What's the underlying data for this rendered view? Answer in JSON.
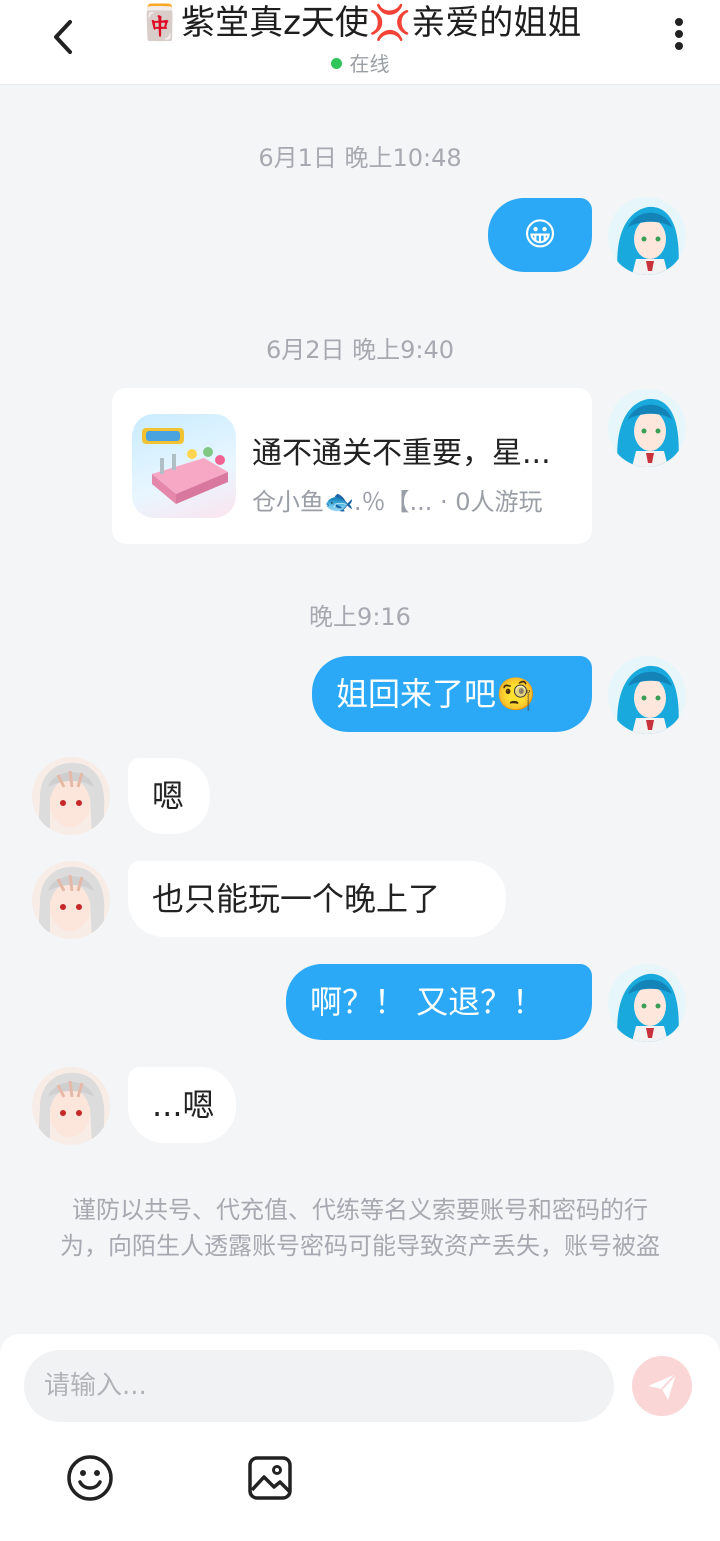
{
  "header": {
    "title": "🀄紫堂真z天使💢亲爱的姐姐",
    "status": "在线",
    "status_color": "#2fc55b"
  },
  "messages": {
    "ts1": "6月1日 晚上10:48",
    "m1": "😀",
    "ts2": "6月2日 晚上9:40",
    "card_title": "通不通关不重要，星...",
    "card_sub": "仓小鱼🐟.％【...  · 0人游玩",
    "ts3": "晚上9:16",
    "m2": "姐回来了吧🧐",
    "m3": "嗯",
    "m4": "也只能玩一个晚上了",
    "m5": "啊？！ 又退？！",
    "m6": "...嗯"
  },
  "notice": "谨防以共号、代充值、代练等名义索要账号和密码的行为，向陌生人透露账号密码可能导致资产丢失，账号被盗",
  "input": {
    "placeholder": "请输入..."
  },
  "colors": {
    "my_bubble": "#2ba8f6",
    "send_button": "#fbd6d6"
  },
  "icons": [
    "back-arrow-icon",
    "more-vertical-icon",
    "send-icon",
    "emoji-icon",
    "image-icon"
  ]
}
